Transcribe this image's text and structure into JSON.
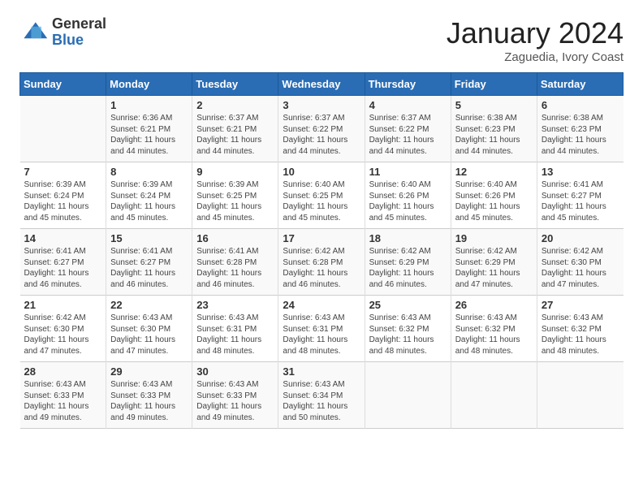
{
  "header": {
    "logo_general": "General",
    "logo_blue": "Blue",
    "month_title": "January 2024",
    "location": "Zaguedia, Ivory Coast"
  },
  "days_of_week": [
    "Sunday",
    "Monday",
    "Tuesday",
    "Wednesday",
    "Thursday",
    "Friday",
    "Saturday"
  ],
  "weeks": [
    [
      {
        "day": "",
        "info": ""
      },
      {
        "day": "1",
        "info": "Sunrise: 6:36 AM\nSunset: 6:21 PM\nDaylight: 11 hours and 44 minutes."
      },
      {
        "day": "2",
        "info": "Sunrise: 6:37 AM\nSunset: 6:21 PM\nDaylight: 11 hours and 44 minutes."
      },
      {
        "day": "3",
        "info": "Sunrise: 6:37 AM\nSunset: 6:22 PM\nDaylight: 11 hours and 44 minutes."
      },
      {
        "day": "4",
        "info": "Sunrise: 6:37 AM\nSunset: 6:22 PM\nDaylight: 11 hours and 44 minutes."
      },
      {
        "day": "5",
        "info": "Sunrise: 6:38 AM\nSunset: 6:23 PM\nDaylight: 11 hours and 44 minutes."
      },
      {
        "day": "6",
        "info": "Sunrise: 6:38 AM\nSunset: 6:23 PM\nDaylight: 11 hours and 44 minutes."
      }
    ],
    [
      {
        "day": "7",
        "info": "Sunrise: 6:39 AM\nSunset: 6:24 PM\nDaylight: 11 hours and 45 minutes."
      },
      {
        "day": "8",
        "info": "Sunrise: 6:39 AM\nSunset: 6:24 PM\nDaylight: 11 hours and 45 minutes."
      },
      {
        "day": "9",
        "info": "Sunrise: 6:39 AM\nSunset: 6:25 PM\nDaylight: 11 hours and 45 minutes."
      },
      {
        "day": "10",
        "info": "Sunrise: 6:40 AM\nSunset: 6:25 PM\nDaylight: 11 hours and 45 minutes."
      },
      {
        "day": "11",
        "info": "Sunrise: 6:40 AM\nSunset: 6:26 PM\nDaylight: 11 hours and 45 minutes."
      },
      {
        "day": "12",
        "info": "Sunrise: 6:40 AM\nSunset: 6:26 PM\nDaylight: 11 hours and 45 minutes."
      },
      {
        "day": "13",
        "info": "Sunrise: 6:41 AM\nSunset: 6:27 PM\nDaylight: 11 hours and 45 minutes."
      }
    ],
    [
      {
        "day": "14",
        "info": "Sunrise: 6:41 AM\nSunset: 6:27 PM\nDaylight: 11 hours and 46 minutes."
      },
      {
        "day": "15",
        "info": "Sunrise: 6:41 AM\nSunset: 6:27 PM\nDaylight: 11 hours and 46 minutes."
      },
      {
        "day": "16",
        "info": "Sunrise: 6:41 AM\nSunset: 6:28 PM\nDaylight: 11 hours and 46 minutes."
      },
      {
        "day": "17",
        "info": "Sunrise: 6:42 AM\nSunset: 6:28 PM\nDaylight: 11 hours and 46 minutes."
      },
      {
        "day": "18",
        "info": "Sunrise: 6:42 AM\nSunset: 6:29 PM\nDaylight: 11 hours and 46 minutes."
      },
      {
        "day": "19",
        "info": "Sunrise: 6:42 AM\nSunset: 6:29 PM\nDaylight: 11 hours and 47 minutes."
      },
      {
        "day": "20",
        "info": "Sunrise: 6:42 AM\nSunset: 6:30 PM\nDaylight: 11 hours and 47 minutes."
      }
    ],
    [
      {
        "day": "21",
        "info": "Sunrise: 6:42 AM\nSunset: 6:30 PM\nDaylight: 11 hours and 47 minutes."
      },
      {
        "day": "22",
        "info": "Sunrise: 6:43 AM\nSunset: 6:30 PM\nDaylight: 11 hours and 47 minutes."
      },
      {
        "day": "23",
        "info": "Sunrise: 6:43 AM\nSunset: 6:31 PM\nDaylight: 11 hours and 48 minutes."
      },
      {
        "day": "24",
        "info": "Sunrise: 6:43 AM\nSunset: 6:31 PM\nDaylight: 11 hours and 48 minutes."
      },
      {
        "day": "25",
        "info": "Sunrise: 6:43 AM\nSunset: 6:32 PM\nDaylight: 11 hours and 48 minutes."
      },
      {
        "day": "26",
        "info": "Sunrise: 6:43 AM\nSunset: 6:32 PM\nDaylight: 11 hours and 48 minutes."
      },
      {
        "day": "27",
        "info": "Sunrise: 6:43 AM\nSunset: 6:32 PM\nDaylight: 11 hours and 48 minutes."
      }
    ],
    [
      {
        "day": "28",
        "info": "Sunrise: 6:43 AM\nSunset: 6:33 PM\nDaylight: 11 hours and 49 minutes."
      },
      {
        "day": "29",
        "info": "Sunrise: 6:43 AM\nSunset: 6:33 PM\nDaylight: 11 hours and 49 minutes."
      },
      {
        "day": "30",
        "info": "Sunrise: 6:43 AM\nSunset: 6:33 PM\nDaylight: 11 hours and 49 minutes."
      },
      {
        "day": "31",
        "info": "Sunrise: 6:43 AM\nSunset: 6:34 PM\nDaylight: 11 hours and 50 minutes."
      },
      {
        "day": "",
        "info": ""
      },
      {
        "day": "",
        "info": ""
      },
      {
        "day": "",
        "info": ""
      }
    ]
  ]
}
